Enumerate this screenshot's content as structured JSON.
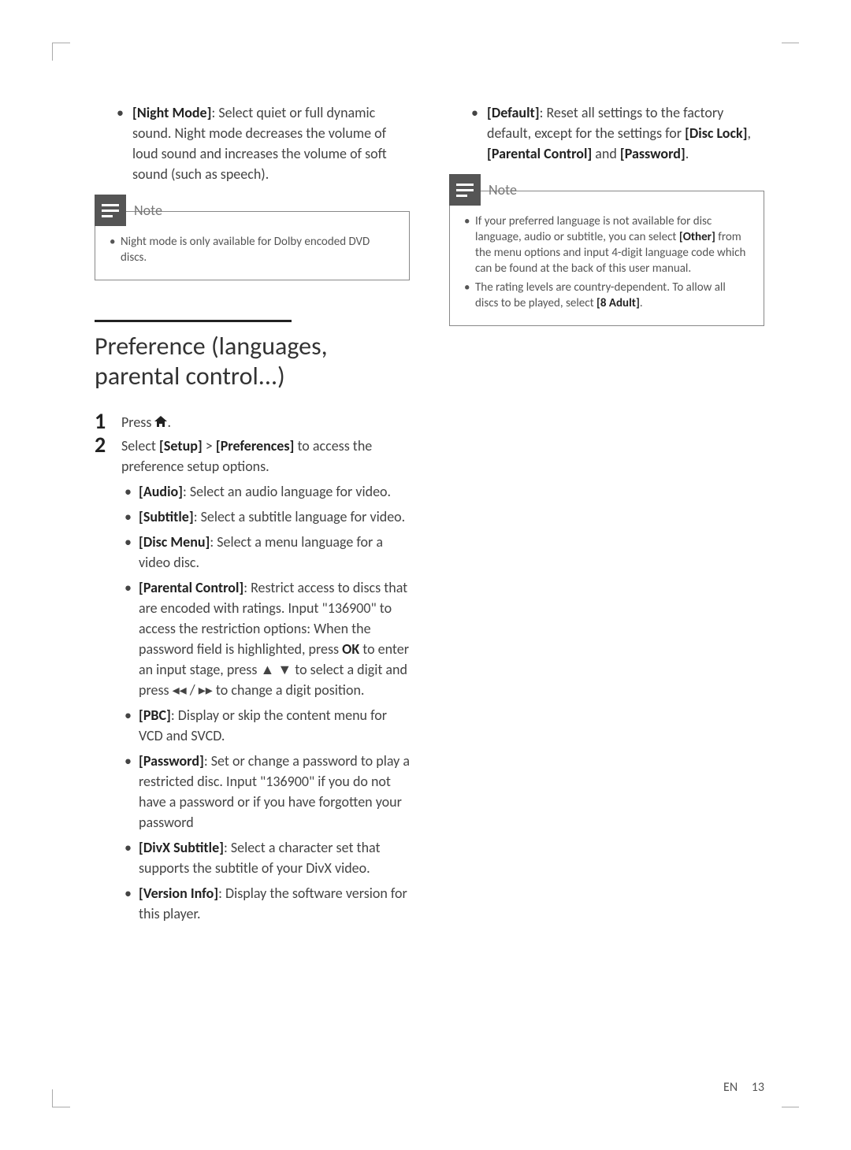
{
  "left": {
    "top_bullet": {
      "label": "[Night Mode]",
      "text": ": Select quiet or full dynamic sound. Night mode decreases the volume of loud sound and increases the volume of soft sound (such as speech)."
    },
    "note": {
      "label": "Note",
      "items": [
        "Night mode is only available for Dolby encoded DVD discs."
      ]
    },
    "section_heading": "Preference (languages, parental control...)",
    "steps": {
      "s1_a": "Press ",
      "s1_b": ".",
      "s2_a": "Select ",
      "s2_b": "[Setup]",
      "s2_c": " > ",
      "s2_d": "[Preferences]",
      "s2_e": " to access the preference setup options."
    },
    "prefs": {
      "audio": {
        "label": "[Audio]",
        "text": ": Select an audio language for video."
      },
      "subtitle": {
        "label": "[Subtitle]",
        "text": ": Select a subtitle language for video."
      },
      "discmenu": {
        "label": "[Disc Menu]",
        "text": ": Select a menu language for a video disc."
      },
      "parental_a": "[Parental Control]",
      "parental_b": ": Restrict access to discs that are encoded with ratings. Input \"136900\" to access the restriction options: When the password field is highlighted, press ",
      "parental_ok": "OK",
      "parental_c": " to enter an input stage, press ",
      "parental_d": " to select a digit and press ",
      "parental_e": " to change a digit position.",
      "pbc": {
        "label": "[PBC]",
        "text": ": Display or skip the content menu for VCD and SVCD."
      },
      "password": {
        "label": "[Password]",
        "text": ": Set or change a password to play a restricted disc. Input \"136900\" if you do not have a password or if you have forgotten your password"
      },
      "divx": {
        "label": "[DivX Subtitle]",
        "text": ": Select a character set that supports the subtitle of your DivX video."
      },
      "version": {
        "label": "[Version Info]",
        "text": ": Display the software version for this player."
      }
    }
  },
  "right": {
    "default_bullet": {
      "label": "[Default]",
      "a": ": Reset all settings to the factory default, except for the settings for ",
      "b": "[Disc Lock]",
      "c": ", ",
      "d": "[Parental Control]",
      "e": " and ",
      "f": "[Password]",
      "g": "."
    },
    "note": {
      "label": "Note",
      "item1_a": "If your preferred language is not available for disc language, audio or subtitle, you can select ",
      "item1_b": "[Other]",
      "item1_c": " from the menu options and input 4-digit language code which can be found at the back of this user manual.",
      "item2_a": "The rating levels are country-dependent. To allow all discs to be played, select ",
      "item2_b": "[8 Adult]",
      "item2_c": "."
    }
  },
  "footer": {
    "lang": "EN",
    "page": "13"
  }
}
